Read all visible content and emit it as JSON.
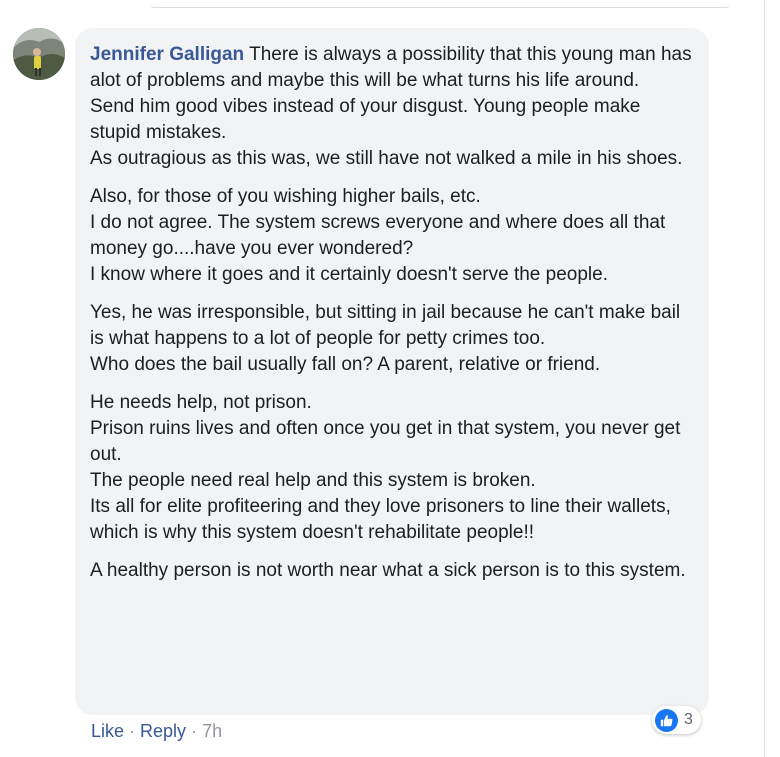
{
  "comment": {
    "author": "Jennifer Galligan",
    "paragraphs": [
      [
        "There is always a possibility that this young man has alot of problems and maybe this will be what turns his life around.",
        "Send him good vibes instead of your disgust. Young people make stupid mistakes.",
        "As outragious as this was, we still have not walked a mile in his shoes."
      ],
      [
        "Also, for those of you wishing higher bails, etc.",
        "I do not agree. The system screws everyone and where does all that money go....have you ever wondered?",
        "I know where it goes and it certainly doesn't serve the people."
      ],
      [
        "Yes, he was irresponsible, but sitting in jail because he can't make bail is what happens to a lot of people for petty crimes too.",
        "Who does the bail usually fall on? A parent, relative or friend."
      ],
      [
        "He needs help, not prison.",
        "Prison ruins lives and often once you get in that system, you never get out.",
        "The people need real help and this system is broken.",
        "Its all for elite profiteering and they love prisoners to line their wallets, which is why this system doesn't rehabilitate people!!"
      ],
      [
        "A healthy person is not worth near what a sick person is to this system."
      ]
    ]
  },
  "reactions": {
    "icon": "thumbs-up-icon",
    "count": "3",
    "color": "#1877f2"
  },
  "actions": {
    "like_label": "Like",
    "separator": "·",
    "reply_label": "Reply",
    "time": "7h"
  }
}
